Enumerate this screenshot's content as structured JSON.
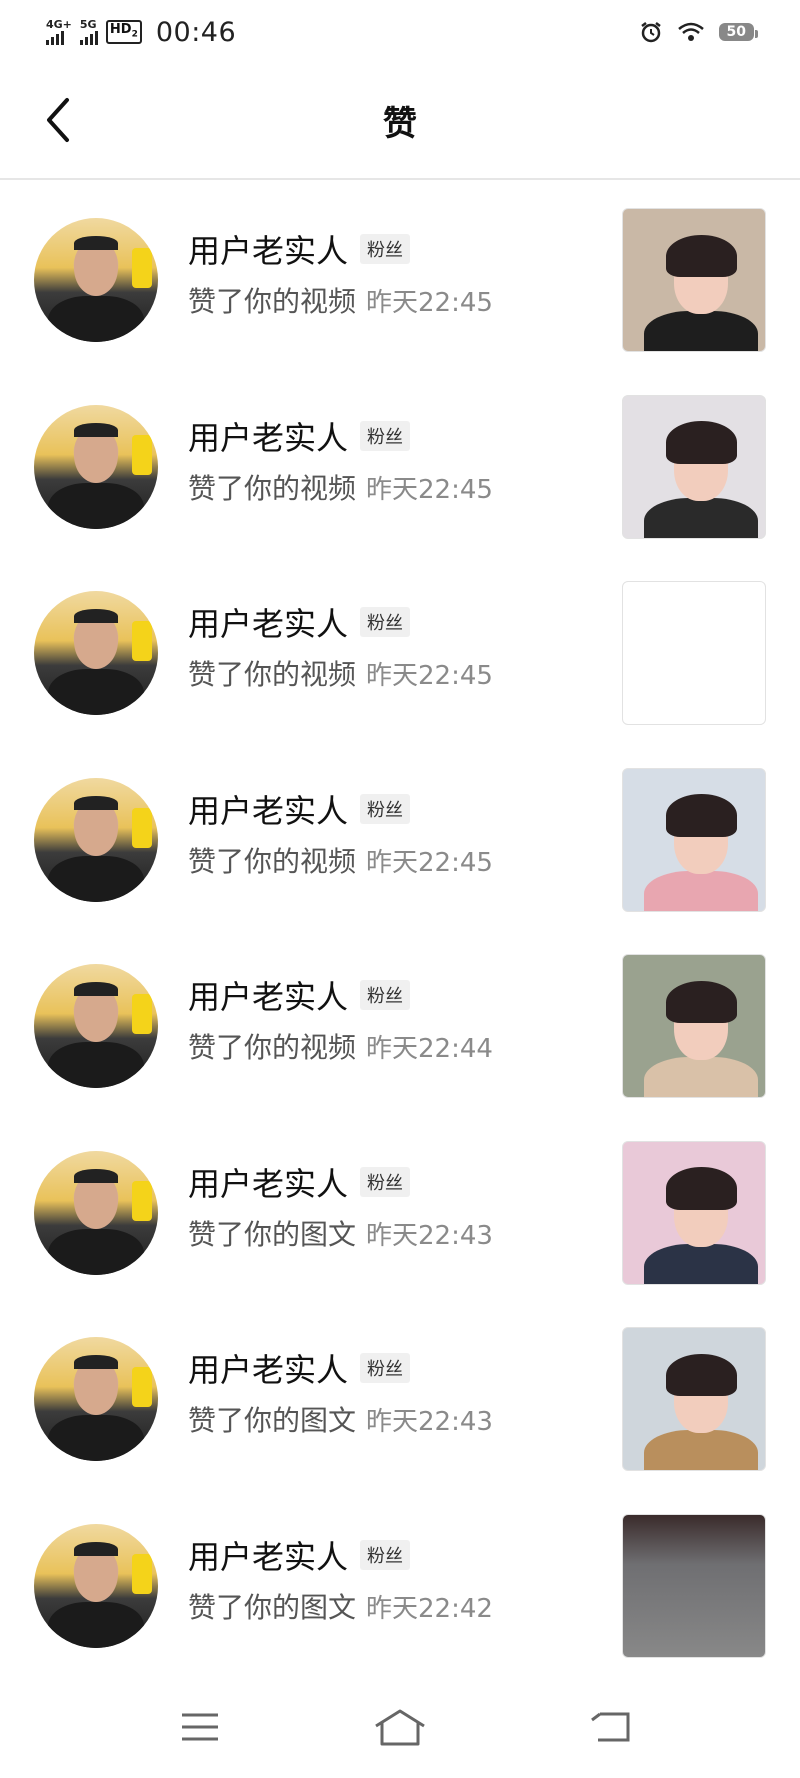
{
  "status_bar": {
    "network1": "4G+",
    "network2": "5G",
    "hd": "HD",
    "hd_sub": "2",
    "time": "00:46",
    "battery": "50",
    "icons": [
      "alarm-icon",
      "wifi-icon"
    ]
  },
  "header": {
    "title": "赞"
  },
  "items": [
    {
      "name": "用户老实人",
      "badge": "粉丝",
      "action": "赞了你的视频",
      "time": "昨天22:45",
      "thumb": {
        "bg": "#c9b8a6",
        "body": "#1e1e1e",
        "has_person": true
      }
    },
    {
      "name": "用户老实人",
      "badge": "粉丝",
      "action": "赞了你的视频",
      "time": "昨天22:45",
      "thumb": {
        "bg": "#e3e0e4",
        "body": "#2a2a2a",
        "has_person": true
      }
    },
    {
      "name": "用户老实人",
      "badge": "粉丝",
      "action": "赞了你的视频",
      "time": "昨天22:45",
      "thumb": {
        "bg": "#ffffff",
        "body": "#ffffff",
        "has_person": false
      }
    },
    {
      "name": "用户老实人",
      "badge": "粉丝",
      "action": "赞了你的视频",
      "time": "昨天22:45",
      "thumb": {
        "bg": "#d6dde6",
        "body": "#e8a6b0",
        "has_person": true
      }
    },
    {
      "name": "用户老实人",
      "badge": "粉丝",
      "action": "赞了你的视频",
      "time": "昨天22:44",
      "thumb": {
        "bg": "#9aa28f",
        "body": "#d9c1a8",
        "has_person": true
      }
    },
    {
      "name": "用户老实人",
      "badge": "粉丝",
      "action": "赞了你的图文",
      "time": "昨天22:43",
      "thumb": {
        "bg": "#e9c9d8",
        "body": "#2b3346",
        "has_person": true
      }
    },
    {
      "name": "用户老实人",
      "badge": "粉丝",
      "action": "赞了你的图文",
      "time": "昨天22:43",
      "thumb": {
        "bg": "#cfd6dc",
        "body": "#b98f5d",
        "has_person": true
      }
    },
    {
      "name": "用户老实人",
      "badge": "粉丝",
      "action": "赞了你的图文",
      "time": "昨天22:42",
      "thumb": {
        "bg": "#6f6f72",
        "body": "#55575c",
        "has_person": false
      }
    }
  ],
  "nav": {
    "icons": [
      "menu-icon",
      "home-icon",
      "back-nav-icon"
    ]
  }
}
